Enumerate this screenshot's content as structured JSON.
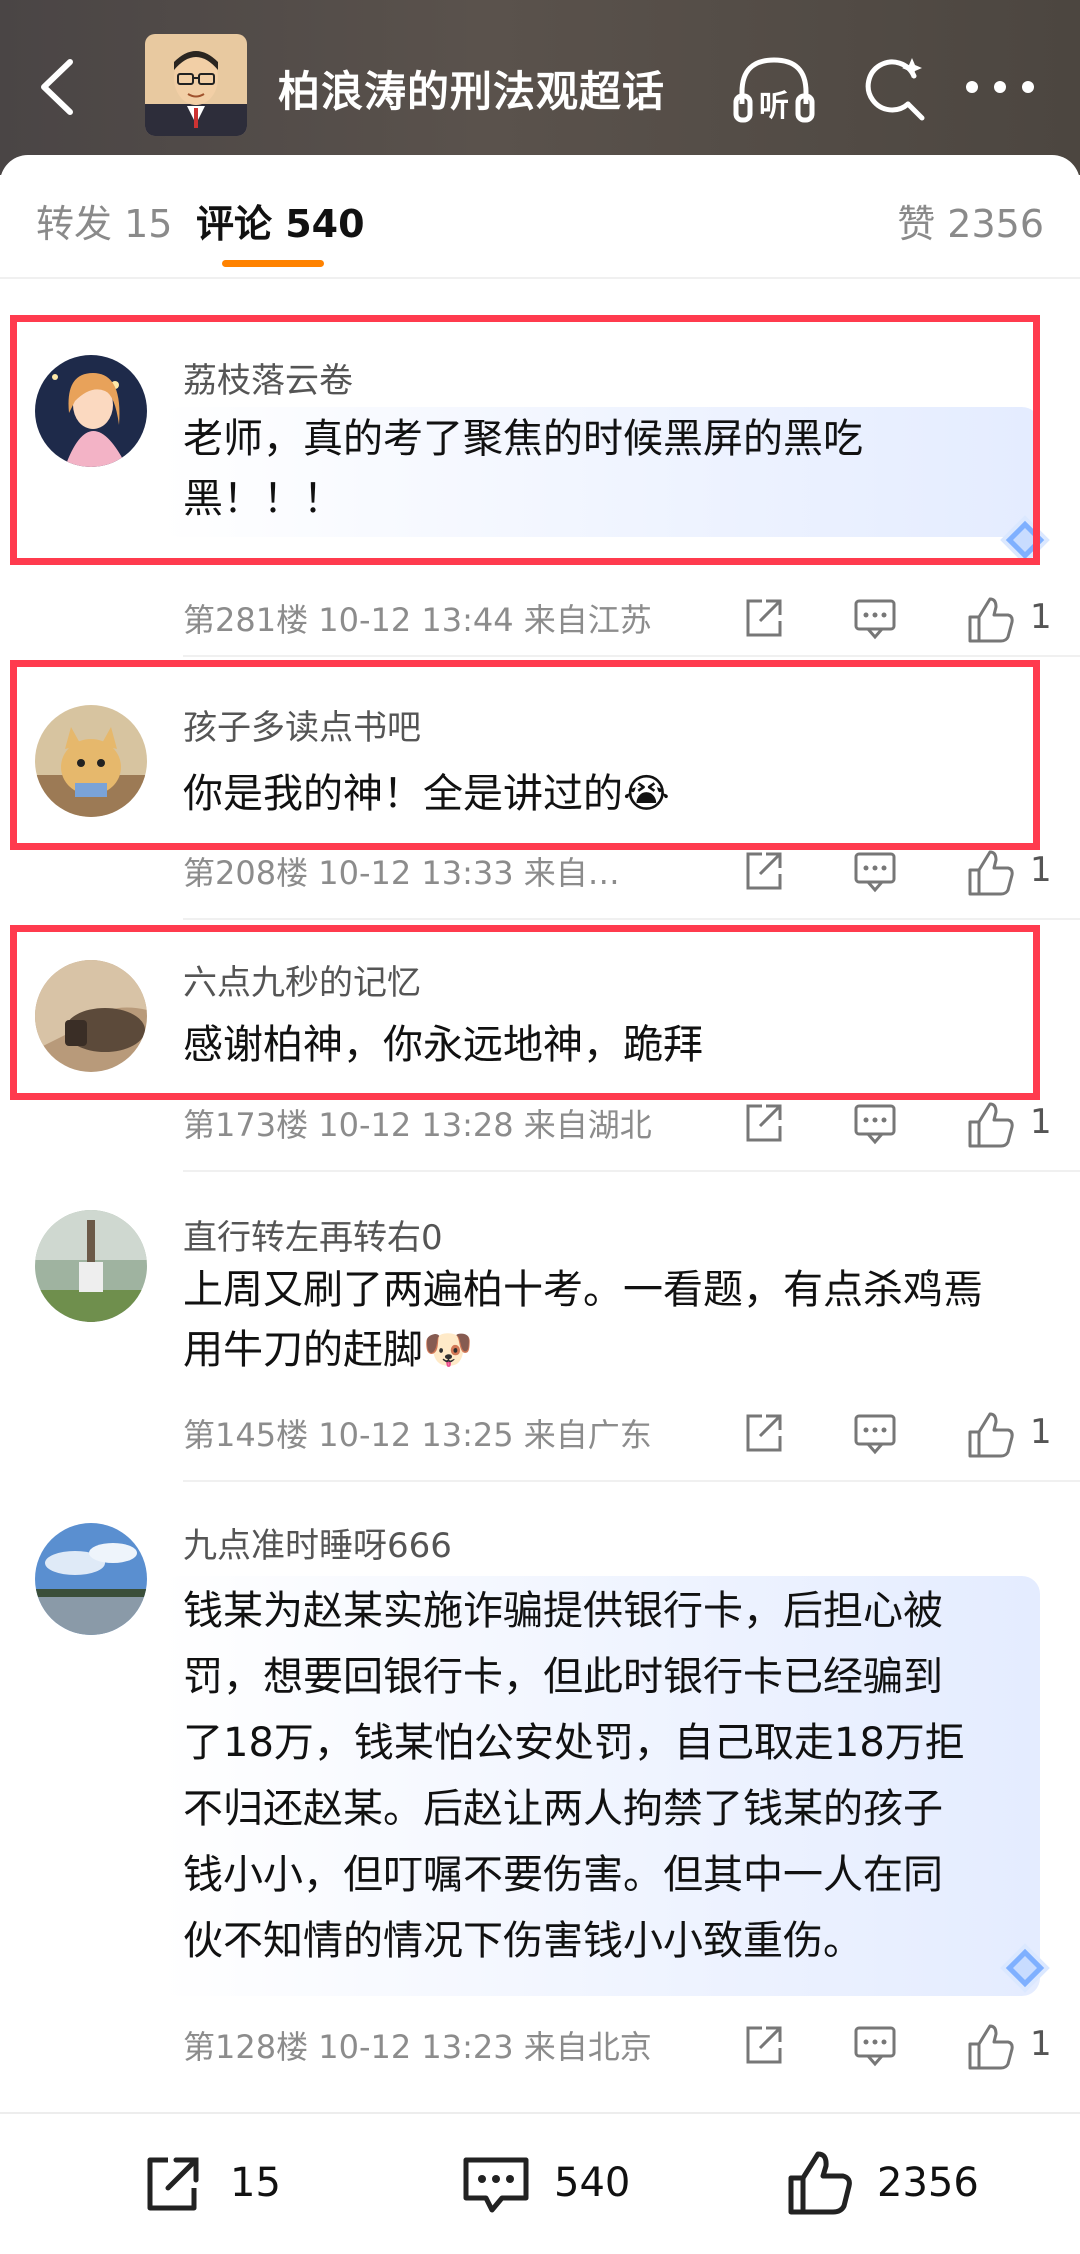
{
  "header": {
    "title": "柏浪涛的刑法观超话",
    "listen_label": "听",
    "avatar_icon": "avatar-man-glasses"
  },
  "tabs": {
    "repost": "转发 15",
    "comments": "评论 540",
    "likes": "赞 2356"
  },
  "colors": {
    "accent": "#ff8200",
    "highlight": "#ff3b4e"
  },
  "comments": [
    {
      "name": "荔枝落云卷",
      "line1": "老师，真的考了聚焦的时候黑屏的黑吃",
      "line2": "黑！！！",
      "meta": "第281楼 10-12 13:44 来自江苏",
      "likes": "1"
    },
    {
      "name": "孩子多读点书吧",
      "line1": "你是我的神！全是讲过的",
      "emoji": "😭",
      "meta": "第208楼 10-12 13:33 来自…",
      "likes": "1"
    },
    {
      "name": "六点九秒的记忆",
      "line1": "感谢柏神，你永远地神，跪拜",
      "meta": "第173楼 10-12 13:28 来自湖北",
      "likes": "1"
    },
    {
      "name": "直行转左再转右0",
      "line1": "上周又刷了两遍柏十考。一看题，有点杀鸡焉",
      "line2": "用牛刀的赶脚",
      "emoji": "🐶",
      "meta": "第145楼 10-12 13:25 来自广东",
      "likes": "1"
    },
    {
      "name": "九点准时睡呀666",
      "lines": [
        "钱某为赵某实施诈骗提供银行卡，后担心被",
        "罚，想要回银行卡，但此时银行卡已经骗到",
        "了18万，钱某怕公安处罚，自己取走18万拒",
        "不归还赵某。后赵让两人拘禁了钱某的孩子",
        "钱小小，但叮嘱不要伤害。但其中一人在同",
        "伙不知情的情况下伤害钱小小致重伤。"
      ],
      "meta": "第128楼 10-12 13:23 来自北京",
      "likes": "1"
    }
  ],
  "bottom_bar": {
    "repost": "15",
    "comment": "540",
    "like": "2356"
  }
}
